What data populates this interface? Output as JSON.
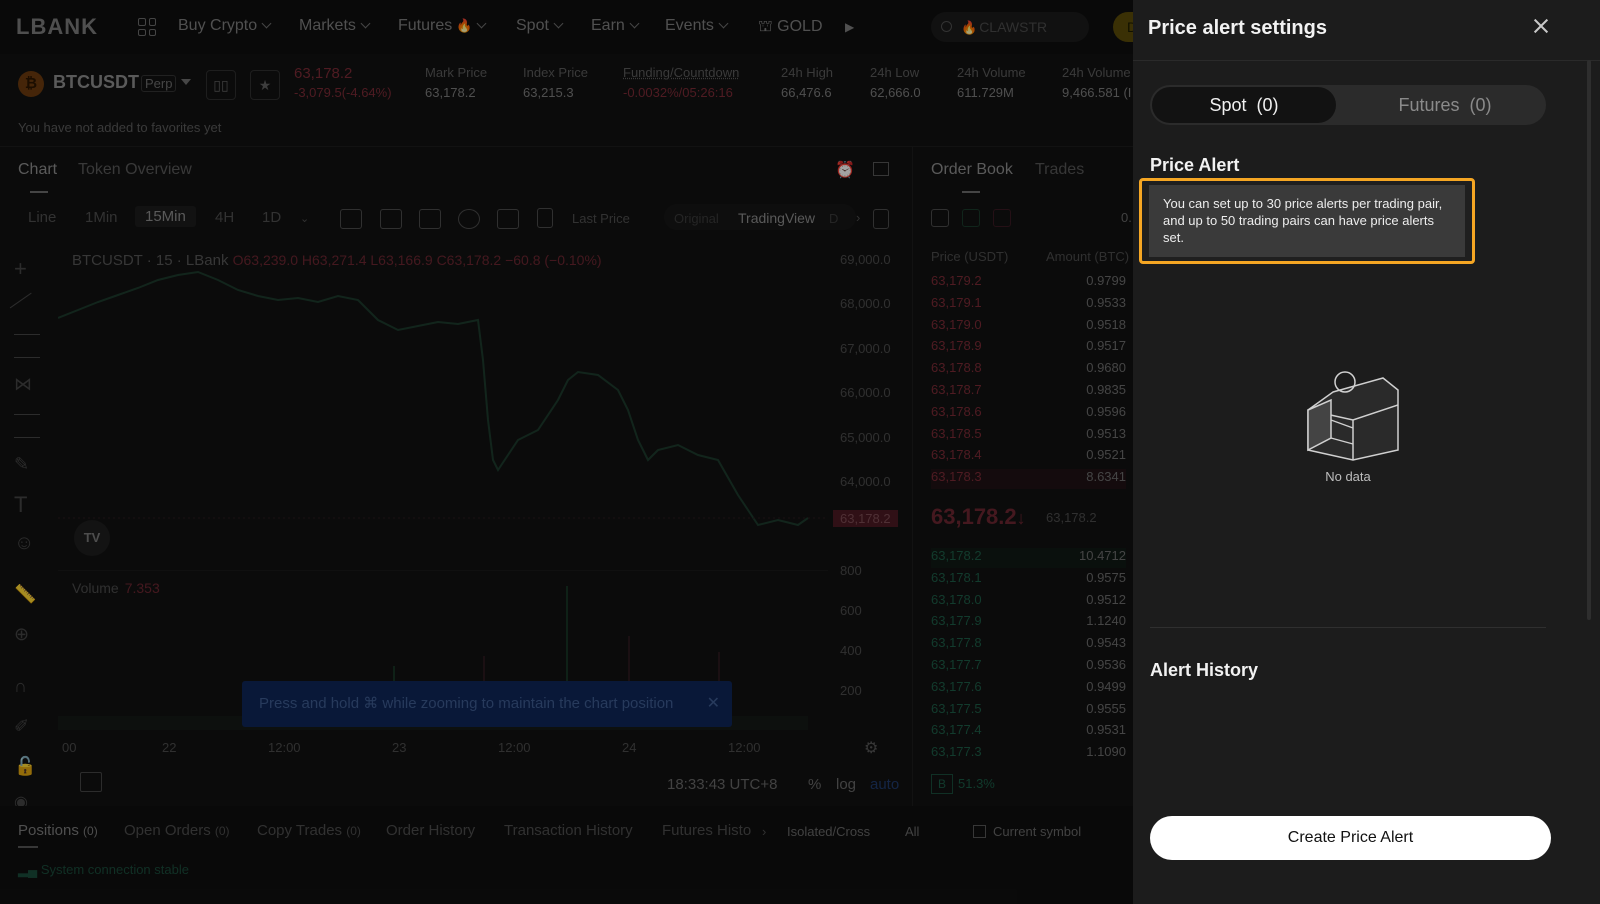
{
  "nav": {
    "logo": "LBANK",
    "items": [
      "Buy Crypto",
      "Markets",
      "Futures",
      "Spot",
      "Earn",
      "Events"
    ],
    "gold": "GOLD",
    "search_placeholder": "CLAWSTR",
    "deposit": "Depo"
  },
  "ticker": {
    "symbol": "BTCUSDT",
    "type": "Perp",
    "price": "63,178.2",
    "change": "-3,079.5(-4.64%)",
    "stats": [
      {
        "k": "Mark Price",
        "v": "63,178.2"
      },
      {
        "k": "Index Price",
        "v": "63,215.3"
      },
      {
        "k": "Funding/Countdown",
        "v": "-0.0032%/05:26:16"
      },
      {
        "k": "24h High",
        "v": "66,476.6"
      },
      {
        "k": "24h Low",
        "v": "62,666.0"
      },
      {
        "k": "24h Volume",
        "v": "611.729M"
      },
      {
        "k": "24h Volume",
        "v": "9,466.581 (I"
      }
    ],
    "fav_note": "You have not added to favorites yet"
  },
  "chart": {
    "tabs": [
      "Chart",
      "Token Overview"
    ],
    "timeframes": [
      "Line",
      "1Min",
      "15Min",
      "4H",
      "1D"
    ],
    "price_type": "Last Price",
    "views": [
      "Original",
      "TradingView",
      "D"
    ],
    "title": "BTCUSDT · 15 · LBank",
    "ohlc": "O63,239.0 H63,271.4 L63,166.9 C63,178.2 −60.8 (−0.10%)",
    "price_ticks": [
      "69,000.0",
      "68,000.0",
      "67,000.0",
      "66,000.0",
      "65,000.0",
      "64,000.0"
    ],
    "current_tag": "63,178.2",
    "vol_ticks": [
      "800",
      "600",
      "400",
      "200"
    ],
    "volume_label": "Volume",
    "volume_value": "7.353",
    "x_ticks": [
      "00",
      "22",
      "12:00",
      "23",
      "12:00",
      "24",
      "12:00"
    ],
    "toast": "Press and hold ⌘ while zooming to maintain the chart position",
    "time": "18:33:43 UTC+8",
    "pct": "%",
    "log": "log",
    "auto": "auto",
    "tv_logo": "TV"
  },
  "orderbook": {
    "tabs": [
      "Order Book",
      "Trades"
    ],
    "head_price": "Price (USDT)",
    "head_amount": "Amount (BTC)",
    "precision": "0.",
    "asks": [
      [
        "63,179.2",
        "0.9799"
      ],
      [
        "63,179.1",
        "0.9533"
      ],
      [
        "63,179.0",
        "0.9518"
      ],
      [
        "63,178.9",
        "0.9517"
      ],
      [
        "63,178.8",
        "0.9680"
      ],
      [
        "63,178.7",
        "0.9835"
      ],
      [
        "63,178.6",
        "0.9596"
      ],
      [
        "63,178.5",
        "0.9513"
      ],
      [
        "63,178.4",
        "0.9521"
      ],
      [
        "63,178.3",
        "8.6341"
      ]
    ],
    "last": "63,178.2",
    "last_arrow": "↓",
    "last_sub": "63,178.2",
    "bids": [
      [
        "63,178.2",
        "10.4712"
      ],
      [
        "63,178.1",
        "0.9575"
      ],
      [
        "63,178.0",
        "0.9512"
      ],
      [
        "63,177.9",
        "1.1240"
      ],
      [
        "63,177.8",
        "0.9543"
      ],
      [
        "63,177.7",
        "0.9536"
      ],
      [
        "63,177.6",
        "0.9499"
      ],
      [
        "63,177.5",
        "0.9555"
      ],
      [
        "63,177.4",
        "0.9531"
      ],
      [
        "63,177.3",
        "1.1090"
      ]
    ],
    "buy_ratio": "51.3%",
    "buy_badge": "B"
  },
  "bottom": {
    "tabs": [
      {
        "label": "Positions",
        "count": "(0)"
      },
      {
        "label": "Open Orders",
        "count": "(0)"
      },
      {
        "label": "Copy Trades",
        "count": "(0)"
      },
      {
        "label": "History",
        "prefix": "Order "
      },
      {
        "label": "Transaction History",
        "count": ""
      },
      {
        "label": "Futures Histo",
        "count": ""
      }
    ],
    "margin_mode": "Isolated/Cross",
    "all": "All",
    "current_symbol": "Current symbol",
    "status": "System connection stable"
  },
  "panel": {
    "title": "Price alert settings",
    "spot_tab": "Spot  (0)",
    "futures_tab": "Futures  (0)",
    "price_alert": "Price Alert",
    "tooltip": "You can set up to 30 price alerts per trading pair, and up to 50 trading pairs can have price alerts set.",
    "no_data": "No data",
    "alert_history": "Alert History",
    "create_btn": "Create Price Alert"
  }
}
